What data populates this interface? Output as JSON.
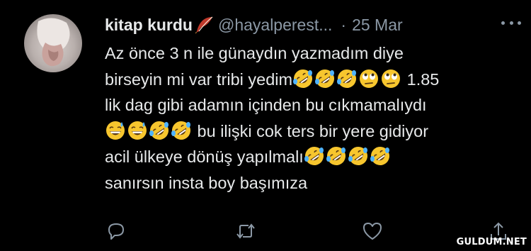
{
  "tweet": {
    "author": {
      "name": "kitap kurdu",
      "name_icon": "feather-icon",
      "handle": "@hayalperest...",
      "avatar_icon": "avatar-photo"
    },
    "separator": "·",
    "date": "25 Mar",
    "more_icon": "more-icon",
    "lines": [
      {
        "pre": "Az önce 3 n ile günaydın yazmadım diye",
        "emojis": [],
        "post": ""
      },
      {
        "pre": "birseyin mi var tribi yedim",
        "emojis": [
          "rofl",
          "rofl",
          "rofl",
          "eye-roll",
          "eye-roll"
        ],
        "post": " 1.85"
      },
      {
        "pre": "lik dag gibi adamın içinden bu cıkmamalıydı",
        "emojis": [],
        "post": ""
      },
      {
        "pre": "",
        "emojis": [
          "sweat-smile",
          "sweat-smile",
          "rofl",
          "rofl"
        ],
        "post": " bu ilişki cok ters bir yere gidiyor"
      },
      {
        "pre": "acil ülkeye dönüş yapılmalı",
        "emojis": [
          "rofl",
          "rofl",
          "rofl",
          "rofl"
        ],
        "post": ""
      },
      {
        "pre": "sanırsın insta boy başımıza",
        "emojis": [],
        "post": ""
      }
    ],
    "actions": [
      "reply-icon",
      "retweet-icon",
      "like-icon",
      "share-icon"
    ]
  },
  "watermark": "GULDUM.NET",
  "colors": {
    "background": "#000000",
    "text": "#e7e9ea",
    "secondary": "#8b98a5",
    "emoji_face": "#f7c62e"
  }
}
